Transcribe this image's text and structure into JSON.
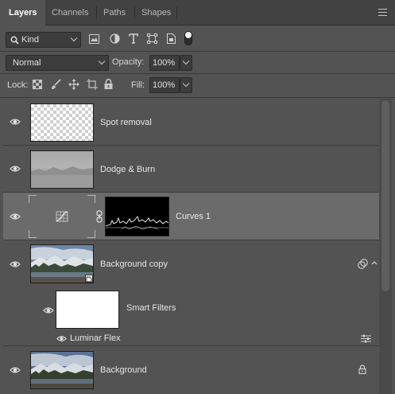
{
  "tabs": [
    {
      "label": "Layers",
      "active": true
    },
    {
      "label": "Channels",
      "active": false
    },
    {
      "label": "Paths",
      "active": false
    },
    {
      "label": "Shapes",
      "active": false
    }
  ],
  "filter": {
    "kind_label": "Kind",
    "icons": [
      "image-filter-icon",
      "adjustment-filter-icon",
      "type-filter-icon",
      "shape-filter-icon",
      "smart-object-filter-icon",
      "filter-toggle-icon"
    ]
  },
  "blend": {
    "mode": "Normal",
    "opacity_label": "Opacity:",
    "opacity_value": "100%"
  },
  "lock": {
    "label": "Lock:",
    "fill_label": "Fill:",
    "fill_value": "100%",
    "icons": [
      "lock-transparent-pixels-icon",
      "lock-image-pixels-icon",
      "lock-position-icon",
      "lock-artboard-icon",
      "lock-all-icon"
    ]
  },
  "layers": [
    {
      "name": "Spot removal",
      "thumb": "transparent",
      "visible": true,
      "selected": false
    },
    {
      "name": "Dodge & Burn",
      "thumb": "gray-landscape",
      "visible": true,
      "selected": false
    },
    {
      "name": "Curves 1",
      "thumb": "curves-adjustment",
      "visible": true,
      "selected": true,
      "mask": true
    },
    {
      "name": "Background copy",
      "thumb": "landscape",
      "visible": true,
      "selected": false,
      "smart_object": true
    },
    {
      "name": "Smart Filters",
      "thumb": "white-mask",
      "visible": true
    },
    {
      "name": "Luminar Flex",
      "visible": true,
      "filter": true
    },
    {
      "name": "Background",
      "thumb": "landscape",
      "visible": true,
      "selected": false,
      "locked": true
    }
  ],
  "colors": {
    "panel": "#535353",
    "tab_bar": "#424242",
    "selected_row": "#6b6b6b",
    "field": "#3c3c3c"
  }
}
